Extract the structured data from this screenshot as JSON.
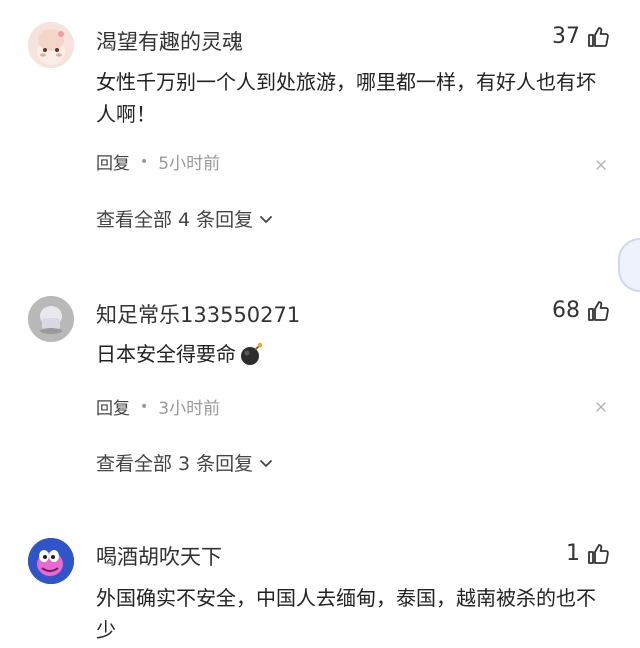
{
  "comments": [
    {
      "username": "渴望有趣的灵魂",
      "likes": "37",
      "content": "女性千万别一个人到处旅游，哪里都一样，有好人也有坏人啊！",
      "reply_label": "回复",
      "time": "5小时前",
      "view_replies": "查看全部 4 条回复"
    },
    {
      "username": "知足常乐133550271",
      "likes": "68",
      "content": "日本安全得要命",
      "emoji": "bomb-emoji",
      "reply_label": "回复",
      "time": "3小时前",
      "view_replies": "查看全部 3 条回复"
    },
    {
      "username": "喝酒胡吹天下",
      "likes": "1",
      "content": "外国确实不安全，中国人去缅甸，泰国，越南被杀的也不少"
    }
  ],
  "icons": {
    "like": "thumbs-up-icon",
    "close": "close-icon",
    "expand": "chevron-down-icon"
  },
  "colors": {
    "text": "#222222",
    "meta": "#999999",
    "accent_tab": "#eef2fb"
  }
}
